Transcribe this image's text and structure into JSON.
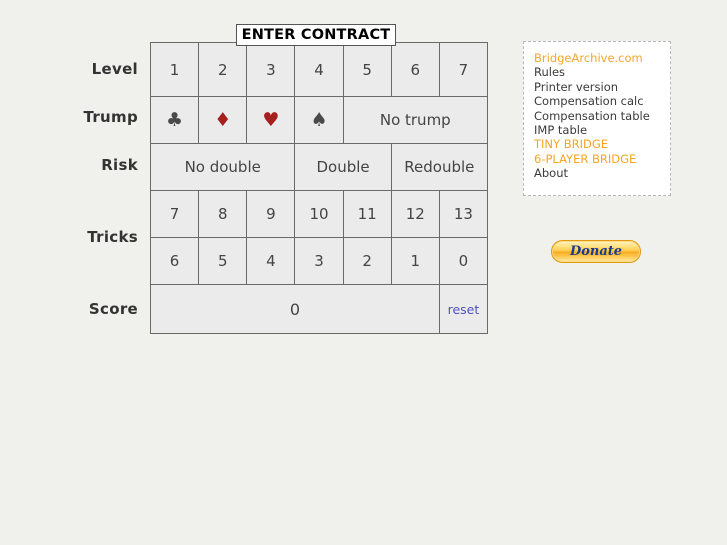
{
  "page": {
    "background": "#f0f0ec",
    "title_badge": "ENTER CONTRACT"
  },
  "calculator": {
    "row_labels": {
      "level": "Level",
      "trump": "Trump",
      "risk": "Risk",
      "tricks": "Tricks",
      "score": "Score"
    },
    "level_row": {
      "name": "Level",
      "cells": [
        "1",
        "2",
        "3",
        "4",
        "5",
        "6",
        "7"
      ]
    },
    "trump_row": {
      "name": "Trump",
      "suits": [
        {
          "glyph": "♣",
          "name": "clubs",
          "color": "black",
          "bg": "#ebebeb"
        },
        {
          "glyph": "♦",
          "name": "diamonds",
          "color": "red",
          "bg": "#fcdada"
        },
        {
          "glyph": "♥",
          "name": "hearts",
          "color": "red",
          "bg": "#fcdada"
        },
        {
          "glyph": "♠",
          "name": "spades",
          "color": "black",
          "bg": "#ebebeb"
        }
      ],
      "no_trump": "No trump",
      "no_trump_bg": "#d3d3f7",
      "no_trump_color": "#27278c"
    },
    "risk_row": {
      "name": "Risk",
      "no_double": "No double",
      "no_double_bg": "#d8ffd8",
      "no_double_color": "#128a12",
      "double": "Double",
      "double_bg": "#fcdada",
      "double_color": "#9e2020",
      "redouble": "Redouble",
      "redouble_bg": "#d3d3f7",
      "redouble_color": "#27278c"
    },
    "tricks_row": {
      "name": "Tricks",
      "made": [
        "7",
        "8",
        "9",
        "10",
        "11",
        "12",
        "13"
      ],
      "down": [
        "6",
        "5",
        "4",
        "3",
        "2",
        "1",
        "0"
      ]
    },
    "score_row": {
      "name": "Score",
      "value": "0",
      "reset_label": "reset",
      "reset_color": "#5050c0"
    }
  },
  "sidebar": {
    "links": [
      {
        "label": "BridgeArchive.com",
        "highlight": true
      },
      {
        "label": "Rules",
        "highlight": false
      },
      {
        "label": "Printer version",
        "highlight": false
      },
      {
        "label": "Compensation calc",
        "highlight": false
      },
      {
        "label": "Compensation table",
        "highlight": false
      },
      {
        "label": "IMP table",
        "highlight": false
      },
      {
        "label": "TINY BRIDGE",
        "highlight": true
      },
      {
        "label": "6-PLAYER BRIDGE",
        "highlight": true
      },
      {
        "label": "About",
        "highlight": false
      }
    ],
    "highlight_color": "#f5a623",
    "text_color": "#3a3a3a"
  },
  "donate": {
    "label": "Donate"
  }
}
